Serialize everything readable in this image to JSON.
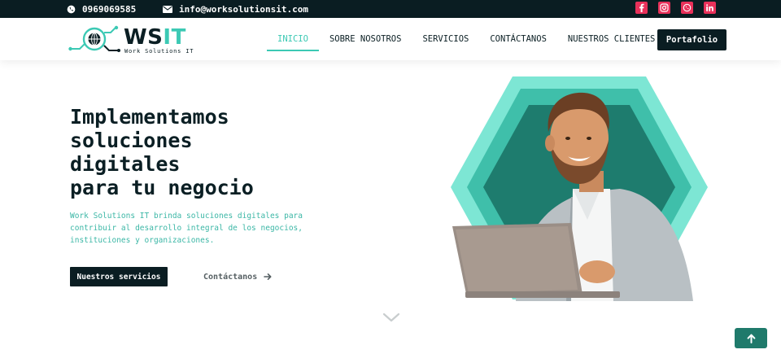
{
  "topbar": {
    "phone": "0969069585",
    "email": "info@worksolutionsit.com",
    "socials": [
      {
        "icon": "facebook-icon"
      },
      {
        "icon": "instagram-icon"
      },
      {
        "icon": "whatsapp-icon"
      },
      {
        "icon": "linkedin-icon"
      }
    ]
  },
  "header": {
    "logo_word_main": "WS",
    "logo_word_accent": "IT",
    "logo_subtitle": "Work Solutions IT",
    "nav": [
      {
        "label": "INICIO",
        "active": true
      },
      {
        "label": "SOBRE NOSOTROS"
      },
      {
        "label": "SERVICIOS"
      },
      {
        "label": "CONTÁCTANOS"
      },
      {
        "label": "NUESTROS CLIENTES"
      }
    ],
    "cta_label": "Portafolio"
  },
  "hero": {
    "title_lines": [
      "Implementamos",
      "soluciones",
      "digitales",
      "para tu negocio"
    ],
    "description": "Work Solutions IT brinda soluciones digitales para contribuir al desarrollo integral de los negocios, instituciones y organizaciones.",
    "primary_button": "Nuestros servicios",
    "secondary_link": "Contáctanos"
  },
  "colors": {
    "dark": "#0a1d22",
    "accent": "#3cc9b4",
    "social": "#e8315a",
    "hex_outer": "#7de6d4",
    "hex_middle": "#3fbfaa",
    "hex_inner": "#1e7c6e"
  }
}
